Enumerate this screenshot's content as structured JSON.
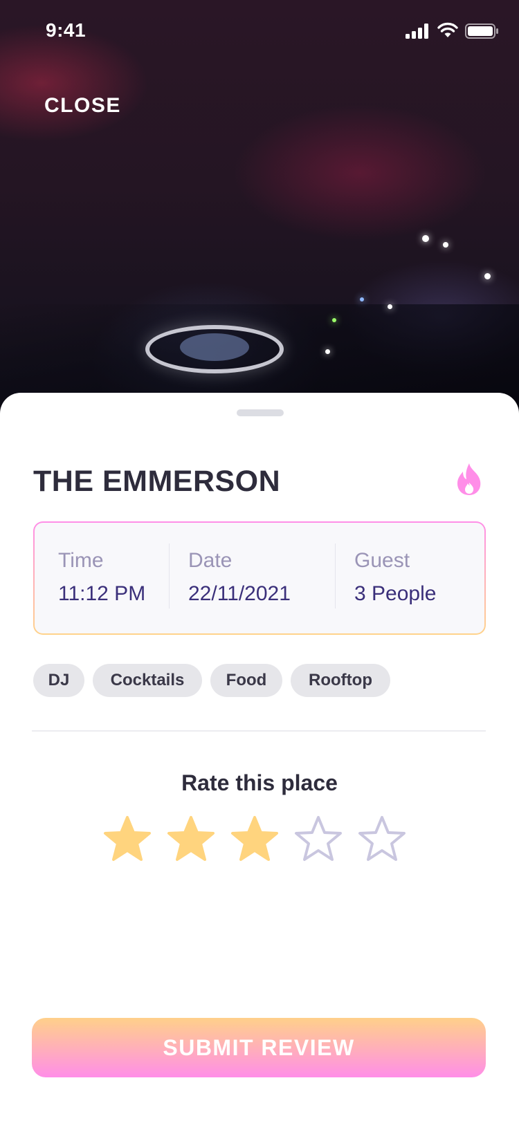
{
  "status_bar": {
    "time": "9:41"
  },
  "header": {
    "close_label": "CLOSE"
  },
  "venue": {
    "name": "THE EMMERSON",
    "badge_icon": "fire-icon",
    "badge_color": "#ff8ee8"
  },
  "booking": {
    "time": {
      "label": "Time",
      "value": "11:12 PM"
    },
    "date": {
      "label": "Date",
      "value": "22/11/2021"
    },
    "guest": {
      "label": "Guest",
      "value": "3 People"
    }
  },
  "tags": [
    "DJ",
    "Cocktails",
    "Food",
    "Rooftop"
  ],
  "rating": {
    "title": "Rate this place",
    "value": 3,
    "max": 5,
    "filled_color": "#ffd47e",
    "empty_color": "#c9c6df"
  },
  "submit": {
    "label": "SUBMIT REVIEW"
  },
  "colors": {
    "title_text": "#2e2c3c",
    "value_text": "#3a2f7a",
    "label_text": "#9a94b6",
    "accent_pink": "#ff8ee8",
    "accent_orange": "#ffd08a"
  }
}
